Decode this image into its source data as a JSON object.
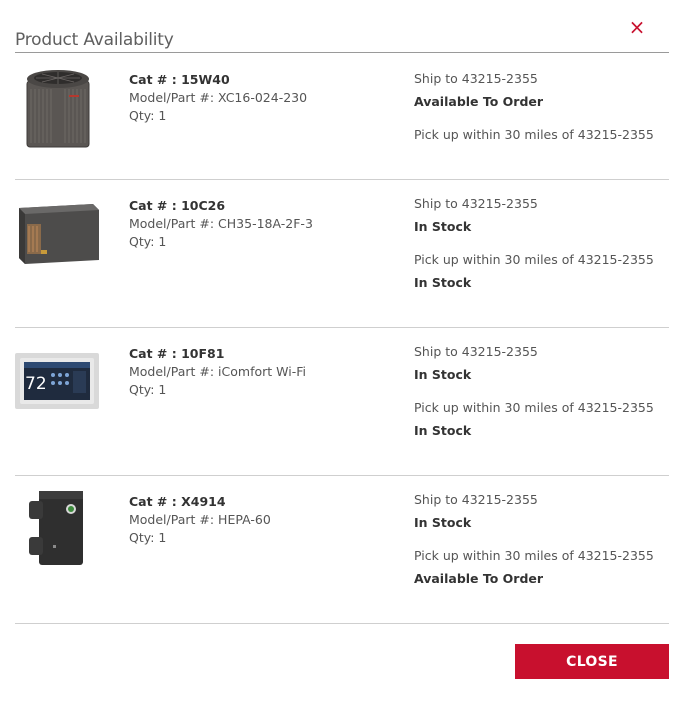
{
  "modal": {
    "title": "Product Availability",
    "close_icon": "×",
    "close_button_label": "CLOSE"
  },
  "colors": {
    "accent": "#c8102e",
    "text": "#555555",
    "rule": "#cfcfcf"
  },
  "products": [
    {
      "image_icon": "outdoor-condenser-unit-image",
      "cat_label": "Cat # : 15W40",
      "model_label": "Model/Part #: XC16-024-230",
      "qty_label": "Qty: 1",
      "ship_label": "Ship to 43215-2355",
      "ship_status": "Available To Order",
      "pickup_label": "Pick up within 30 miles of 43215-2355",
      "pickup_status": ""
    },
    {
      "image_icon": "evaporator-coil-image",
      "cat_label": "Cat # : 10C26",
      "model_label": "Model/Part #: CH35-18A-2F-3",
      "qty_label": "Qty: 1",
      "ship_label": "Ship to 43215-2355",
      "ship_status": "In Stock",
      "pickup_label": "Pick up within 30 miles of 43215-2355",
      "pickup_status": "In Stock"
    },
    {
      "image_icon": "smart-thermostat-image",
      "thermostat_reading": "72",
      "cat_label": "Cat # : 10F81",
      "model_label": "Model/Part #: iComfort Wi-Fi",
      "qty_label": "Qty: 1",
      "ship_label": "Ship to 43215-2355",
      "ship_status": "In Stock",
      "pickup_label": "Pick up within 30 miles of 43215-2355",
      "pickup_status": "In Stock"
    },
    {
      "image_icon": "hepa-air-filter-image",
      "cat_label": "Cat # : X4914",
      "model_label": "Model/Part #: HEPA-60",
      "qty_label": "Qty: 1",
      "ship_label": "Ship to 43215-2355",
      "ship_status": "In Stock",
      "pickup_label": "Pick up within 30 miles of 43215-2355",
      "pickup_status": "Available To Order"
    }
  ]
}
